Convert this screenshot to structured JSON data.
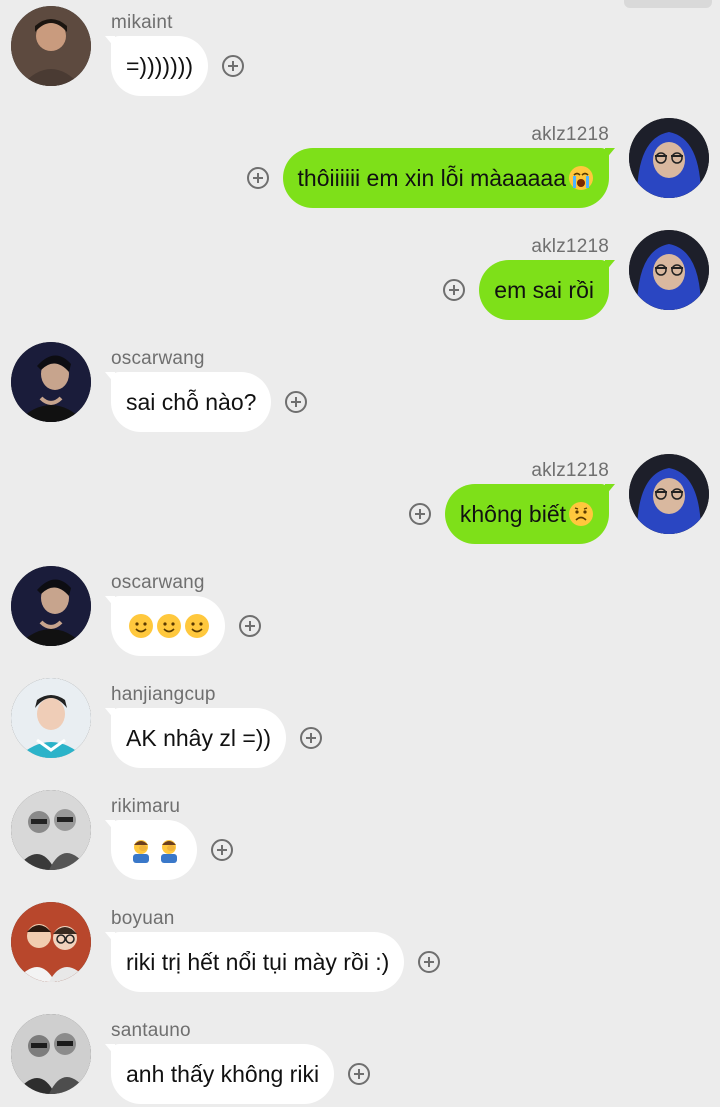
{
  "messages": [
    {
      "side": "in",
      "avatar": "mikaint-avatar",
      "sender": "mikaint",
      "text": "=)))))))",
      "emoji": []
    },
    {
      "side": "out",
      "avatar": "aklz1218-avatar",
      "sender": "aklz1218",
      "text": "thôiiiiii em xin lỗi màaaaaa",
      "emoji": [
        "loudly-crying-face"
      ]
    },
    {
      "side": "out",
      "avatar": "aklz1218-avatar",
      "sender": "aklz1218",
      "text": "em sai rồi",
      "emoji": []
    },
    {
      "side": "in",
      "avatar": "oscarwang-avatar",
      "sender": "oscarwang",
      "text": "sai chỗ nào?",
      "emoji": []
    },
    {
      "side": "out",
      "avatar": "aklz1218-avatar",
      "sender": "aklz1218",
      "text": "không biết",
      "emoji": [
        "sad-face"
      ]
    },
    {
      "side": "in",
      "avatar": "oscarwang-avatar",
      "sender": "oscarwang",
      "text": "",
      "emoji": [
        "smiling-face",
        "smiling-face",
        "smiling-face"
      ]
    },
    {
      "side": "in",
      "avatar": "hanjiangcup-avatar",
      "sender": "hanjiangcup",
      "text": "AK nhây zl =))",
      "emoji": []
    },
    {
      "side": "in",
      "avatar": "rikimaru-avatar",
      "sender": "rikimaru",
      "text": "",
      "emoji": [
        "facepalm-person",
        "facepalm-person"
      ]
    },
    {
      "side": "in",
      "avatar": "boyuan-avatar",
      "sender": "boyuan",
      "text": "riki trị hết nổi tụi mày rồi :)",
      "emoji": []
    },
    {
      "side": "in",
      "avatar": "santauno-avatar",
      "sender": "santauno",
      "text": "anh thấy không riki",
      "emoji": []
    }
  ],
  "colors": {
    "background": "#ececec",
    "incoming_bubble": "#ffffff",
    "outgoing_bubble": "#7ee019",
    "meta_text": "#6f6f6f"
  }
}
